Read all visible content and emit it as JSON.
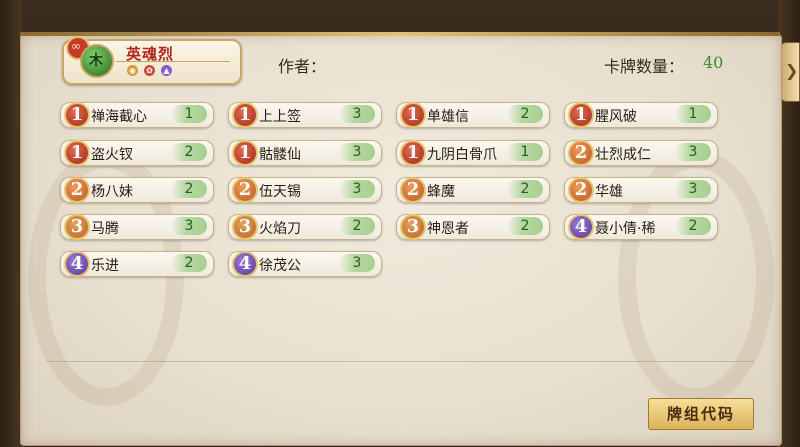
{
  "deck": {
    "name": "英魂烈",
    "hero_symbol": "木",
    "author_label": "作者：",
    "count_label": "卡牌数量：",
    "count_value": "40"
  },
  "nav": {
    "side_tab_icon": "chevron-right-icon"
  },
  "mini_icons": [
    "gold",
    "red",
    "purple"
  ],
  "cards": [
    {
      "cost": "1",
      "name": "禅海截心",
      "qty": "1"
    },
    {
      "cost": "1",
      "name": "上上签",
      "qty": "3"
    },
    {
      "cost": "1",
      "name": "单雄信",
      "qty": "2"
    },
    {
      "cost": "1",
      "name": "腥风破",
      "qty": "1"
    },
    {
      "cost": "1",
      "name": "盗火钗",
      "qty": "2"
    },
    {
      "cost": "1",
      "name": "骷髅仙",
      "qty": "3"
    },
    {
      "cost": "1",
      "name": "九阴白骨爪",
      "qty": "1"
    },
    {
      "cost": "2",
      "name": "壮烈成仁",
      "qty": "3"
    },
    {
      "cost": "2",
      "name": "杨八妹",
      "qty": "2"
    },
    {
      "cost": "2",
      "name": "伍天锡",
      "qty": "3"
    },
    {
      "cost": "2",
      "name": "蜂魔",
      "qty": "2"
    },
    {
      "cost": "2",
      "name": "华雄",
      "qty": "3"
    },
    {
      "cost": "3",
      "name": "马腾",
      "qty": "3"
    },
    {
      "cost": "3",
      "name": "火焰刀",
      "qty": "2"
    },
    {
      "cost": "3",
      "name": "神恩者",
      "qty": "2"
    },
    {
      "cost": "4",
      "name": "聂小倩·稀",
      "qty": "2"
    },
    {
      "cost": "4",
      "name": "乐进",
      "qty": "2"
    },
    {
      "cost": "4",
      "name": "徐茂公",
      "qty": "3"
    }
  ],
  "buttons": {
    "deck_code": "牌组代码"
  }
}
